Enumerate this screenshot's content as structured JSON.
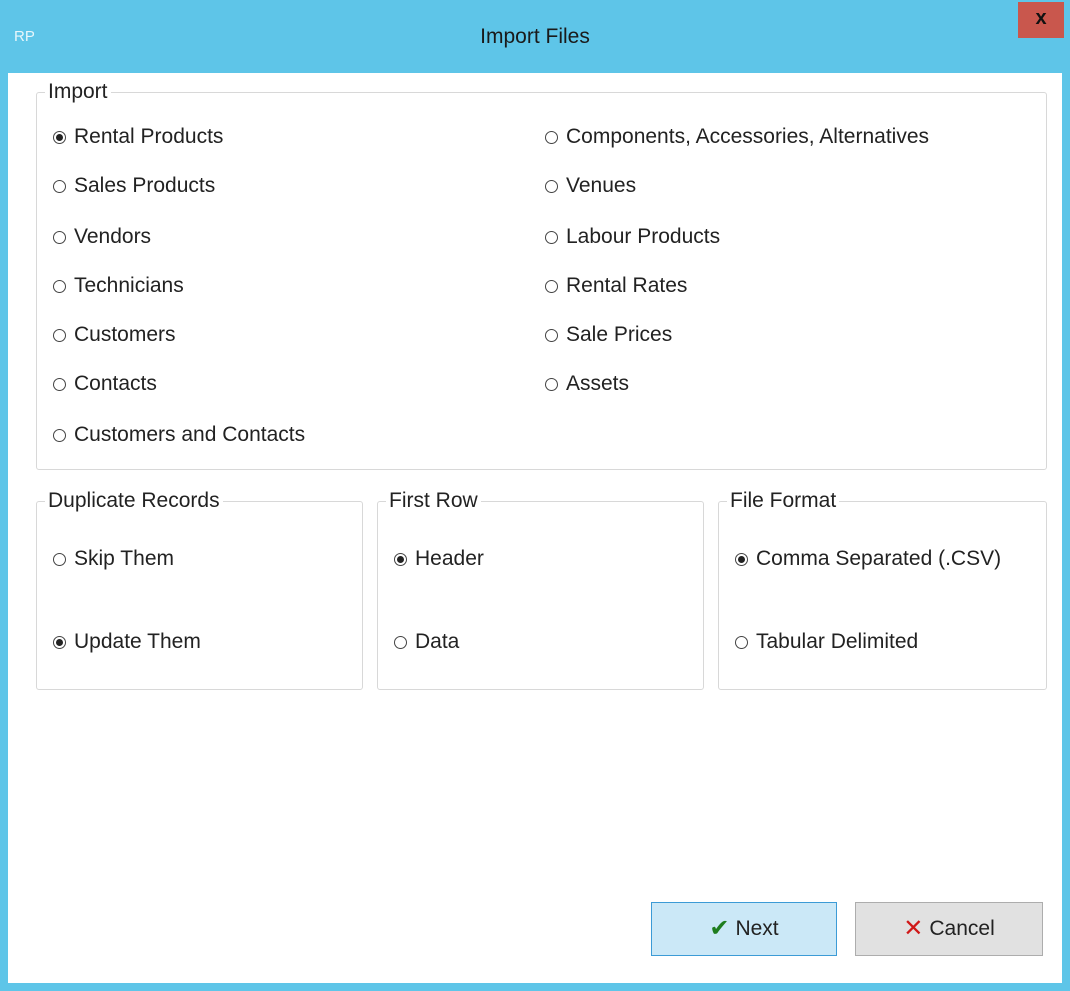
{
  "window": {
    "app_icon_text": "RP",
    "title": "Import Files",
    "close_label": "x"
  },
  "import_group": {
    "legend": "Import",
    "left_options": [
      {
        "label": "Rental Products",
        "checked": true
      },
      {
        "label": "Sales Products",
        "checked": false
      },
      {
        "label": "Vendors",
        "checked": false
      },
      {
        "label": "Technicians",
        "checked": false
      },
      {
        "label": "Customers",
        "checked": false
      },
      {
        "label": "Contacts",
        "checked": false
      },
      {
        "label": "Customers and Contacts",
        "checked": false
      }
    ],
    "right_options": [
      {
        "label": "Components, Accessories, Alternatives",
        "checked": false
      },
      {
        "label": "Venues",
        "checked": false
      },
      {
        "label": "Labour Products",
        "checked": false
      },
      {
        "label": "Rental Rates",
        "checked": false
      },
      {
        "label": "Sale Prices",
        "checked": false
      },
      {
        "label": "Assets",
        "checked": false
      }
    ]
  },
  "duplicate_group": {
    "legend": "Duplicate Records",
    "options": [
      {
        "label": "Skip Them",
        "checked": false
      },
      {
        "label": "Update Them",
        "checked": true
      }
    ]
  },
  "first_row_group": {
    "legend": "First Row",
    "options": [
      {
        "label": "Header",
        "checked": true
      },
      {
        "label": "Data",
        "checked": false
      }
    ]
  },
  "file_format_group": {
    "legend": "File Format",
    "options": [
      {
        "label": "Comma Separated (.CSV)",
        "checked": true
      },
      {
        "label": "Tabular Delimited",
        "checked": false
      }
    ]
  },
  "buttons": {
    "next_label": "Next",
    "cancel_label": "Cancel"
  },
  "colors": {
    "title_bar": "#5ec5e8",
    "close_button": "#c9574d",
    "next_button_bg": "#cbe8f7",
    "next_button_border": "#3c9bd6"
  },
  "icons": {
    "next": "check-icon",
    "cancel": "x-icon"
  }
}
